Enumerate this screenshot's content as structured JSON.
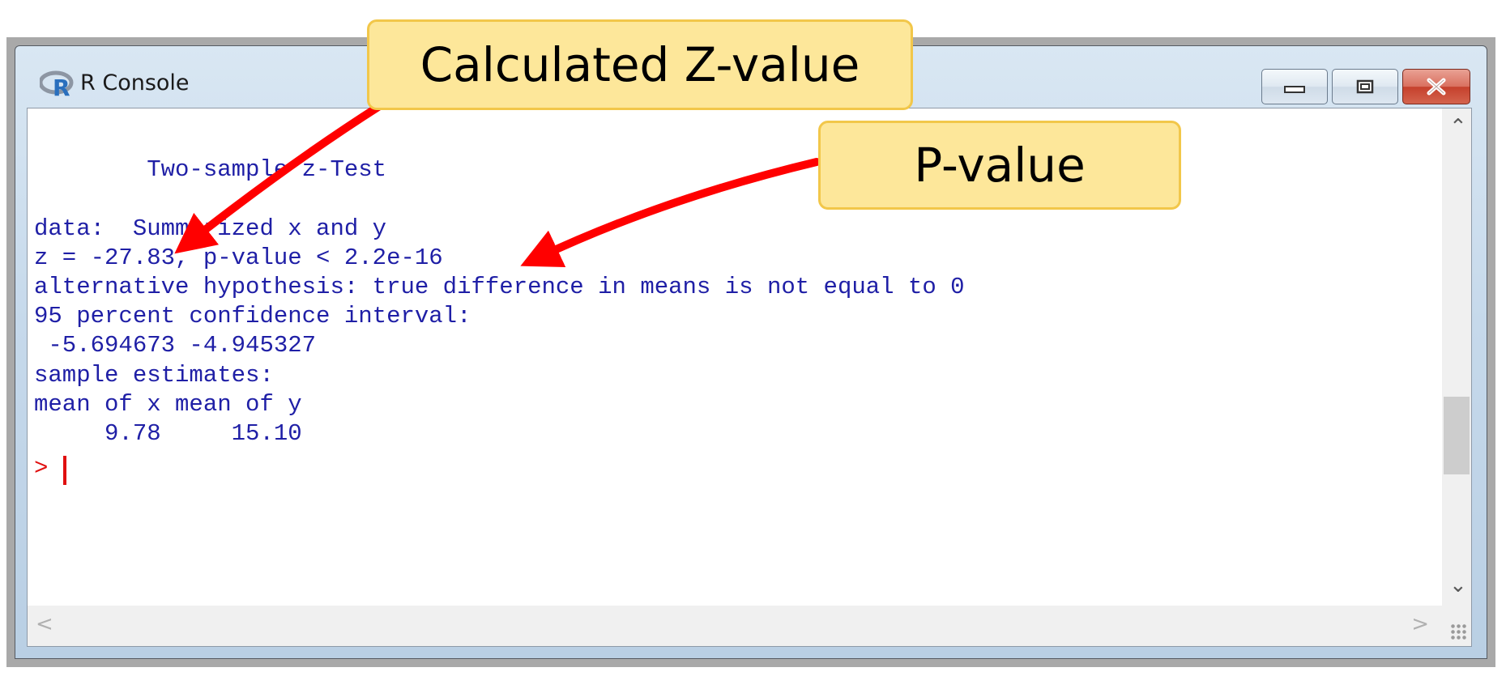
{
  "window": {
    "title": "R Console",
    "logo_letter": "R",
    "controls": {
      "minimize_symbol": "▭",
      "maximize_symbol": "□",
      "close_symbol": "✕"
    }
  },
  "console": {
    "lines": [
      "",
      "        Two-sample z-Test",
      "",
      "data:  Summarized x and y",
      "z = -27.83, p-value < 2.2e-16",
      "alternative hypothesis: true difference in means is not equal to 0",
      "95 percent confidence interval:",
      " -5.694673 -4.945327",
      "sample estimates:",
      "mean of x mean of y ",
      "     9.78     15.10 "
    ],
    "prompt": ">"
  },
  "scrollbar": {
    "up_arrow": "⌃",
    "down_arrow": "⌄",
    "left_arrow": "<",
    "right_arrow": ">"
  },
  "callouts": {
    "z_value_label": "Calculated Z-value",
    "p_value_label": "P-value"
  },
  "colors": {
    "console_text": "#1f1fa6",
    "prompt": "#e01010",
    "callout_fill": "#fde79a",
    "callout_border": "#f2c74a",
    "arrow": "#ff0000"
  }
}
